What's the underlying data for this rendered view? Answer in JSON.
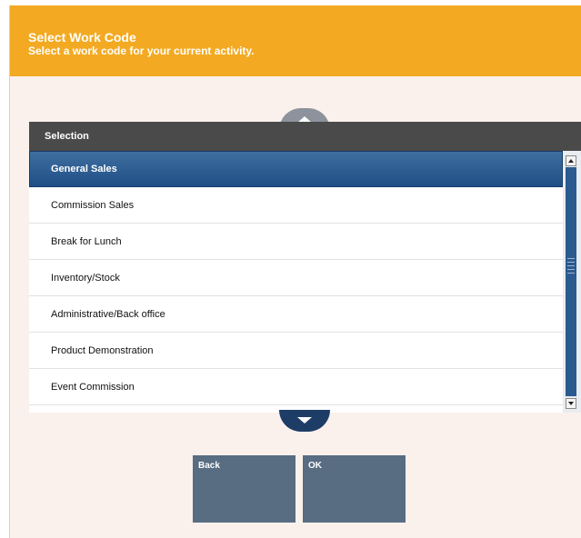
{
  "header": {
    "title": "Select Work Code",
    "subtitle": "Select a work code for your current activity.",
    "background_color": "#f3aa22"
  },
  "list": {
    "column_header": "Selection",
    "selected_index": 0,
    "items": [
      {
        "label": "General Sales"
      },
      {
        "label": "Commission Sales"
      },
      {
        "label": "Break for Lunch"
      },
      {
        "label": "Inventory/Stock"
      },
      {
        "label": "Administrative/Back office"
      },
      {
        "label": "Product Demonstration"
      },
      {
        "label": "Event Commission"
      }
    ]
  },
  "navigation": {
    "scroll_up_icon": "chevron-up-icon",
    "scroll_down_icon": "chevron-down-icon"
  },
  "actions": {
    "back_label": "Back",
    "ok_label": "OK"
  },
  "colors": {
    "accent": "#f3aa22",
    "selection": "#2a5a8f",
    "button": "#586c82",
    "list_header": "#4a4a4a"
  }
}
